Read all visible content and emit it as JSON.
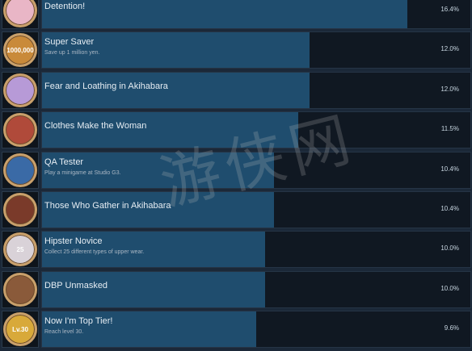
{
  "achievements": [
    {
      "title": "Detention!",
      "desc": "",
      "pct": "16.4%",
      "progress": 0.164,
      "icon": "detention-icon",
      "badge_text": "",
      "badge_bg": "#e9b6c6"
    },
    {
      "title": "Super Saver",
      "desc": "Save up 1 million yen.",
      "pct": "12.0%",
      "progress": 0.12,
      "icon": "super-saver-icon",
      "badge_text": "1000,000",
      "badge_bg": "#c98a3a"
    },
    {
      "title": "Fear and Loathing in Akihabara",
      "desc": "",
      "pct": "12.0%",
      "progress": 0.12,
      "icon": "fear-loathing-icon",
      "badge_text": "",
      "badge_bg": "#b79ad7"
    },
    {
      "title": "Clothes Make the Woman",
      "desc": "",
      "pct": "11.5%",
      "progress": 0.115,
      "icon": "clothes-icon",
      "badge_text": "",
      "badge_bg": "#b04a3a"
    },
    {
      "title": "QA Tester",
      "desc": "Play a minigame at Studio G3.",
      "pct": "10.4%",
      "progress": 0.104,
      "icon": "qa-tester-icon",
      "badge_text": "",
      "badge_bg": "#3a6aa6"
    },
    {
      "title": "Those Who Gather in Akihabara",
      "desc": "",
      "pct": "10.4%",
      "progress": 0.104,
      "icon": "gather-icon",
      "badge_text": "",
      "badge_bg": "#7a3a2a"
    },
    {
      "title": "Hipster Novice",
      "desc": "Collect 25 different types of upper wear.",
      "pct": "10.0%",
      "progress": 0.1,
      "icon": "hipster-icon",
      "badge_text": "25",
      "badge_bg": "#d9d2d8"
    },
    {
      "title": "DBP Unmasked",
      "desc": "",
      "pct": "10.0%",
      "progress": 0.1,
      "icon": "dbp-icon",
      "badge_text": "",
      "badge_bg": "#8a5a3a"
    },
    {
      "title": "Now I'm Top Tier!",
      "desc": "Reach level 30.",
      "pct": "9.6%",
      "progress": 0.096,
      "icon": "top-tier-icon",
      "badge_text": "Lv.30",
      "badge_bg": "#d8a93a"
    }
  ],
  "watermark": "游侠网"
}
